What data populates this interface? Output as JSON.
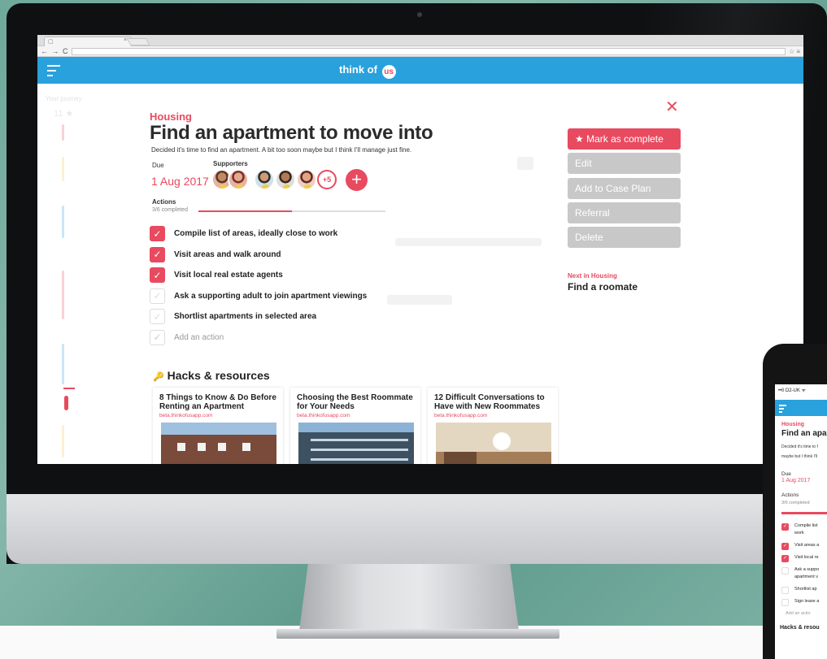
{
  "browser": {
    "tab_close": "×",
    "nav_buttons": "← → C",
    "toolbar_icons": "☆ ≡"
  },
  "app": {
    "logo_text": "think of",
    "logo_badge": "us"
  },
  "background_sidebar": {
    "journey_label": "Your journey",
    "journey_stars": "11 ★"
  },
  "task": {
    "category": "Housing",
    "title": "Find an apartment to move into",
    "description": "Decided it's time to find an apartment. A bit too soon maybe but I think I'll manage just fine.",
    "due_label": "Due",
    "due_date": "1 Aug 2017",
    "supporters_label": "Supporters",
    "supporters_extra": "+5",
    "add_supporter": "+",
    "actions_label": "Actions",
    "actions_completed": "3/6 completed",
    "progress_fraction": 0.5,
    "actions": [
      {
        "label": "Compile list of areas, ideally close to work",
        "done": true
      },
      {
        "label": "Visit areas and walk around",
        "done": true
      },
      {
        "label": "Visit local real estate agents",
        "done": true
      },
      {
        "label": "Ask a supporting adult to join apartment viewings",
        "done": false
      },
      {
        "label": "Shortlist apartments in selected area",
        "done": false
      }
    ],
    "add_action_placeholder": "Add an action",
    "check_glyph": "✓"
  },
  "hacks": {
    "icon": "key-icon",
    "heading": "Hacks & resources",
    "cards": [
      {
        "title": "8 Things to Know & Do Before Renting an Apartment",
        "source": "beta.thinkofusapp.com"
      },
      {
        "title": "Choosing the Best Roommate for Your Needs",
        "source": "beta.thinkofusapp.com"
      },
      {
        "title": "12 Difficult Conversations to Have with New Roommates",
        "source": "beta.thinkofusapp.com"
      }
    ]
  },
  "side_panel": {
    "close": "✕",
    "mark_complete": "★ Mark as complete",
    "edit": "Edit",
    "add_to_case_plan": "Add to Case Plan",
    "referral": "Referral",
    "delete": "Delete",
    "next_label": "Next in Housing",
    "next_title": "Find a roomate"
  },
  "phone": {
    "status": "••ll O2-UK ᯤ",
    "category": "Housing",
    "title": "Find an apa",
    "desc_line1": "Decided it's time to f",
    "desc_line2": "maybe but I think I'll",
    "due_label": "Due",
    "due_date": "1 Aug 2017",
    "actions_label": "Actions",
    "actions_completed": "3/6 completed",
    "actions": [
      {
        "label": "Compile list",
        "done": true
      },
      {
        "label": "work",
        "done": null
      },
      {
        "label": "Visit areas a",
        "done": true
      },
      {
        "label": "Visit local re",
        "done": true
      },
      {
        "label": "Ask a suppo",
        "done": false
      },
      {
        "label": "apartment v",
        "done": null
      },
      {
        "label": "Shortlist ap",
        "done": false
      },
      {
        "label": "Sign lease a",
        "done": false
      }
    ],
    "add_action": "Add an actio",
    "hacks_heading": "Hacks & resou"
  },
  "colors": {
    "accent": "#e84a5f",
    "app_bar": "#29a1dc",
    "disabled_button": "#c8c8c8"
  }
}
